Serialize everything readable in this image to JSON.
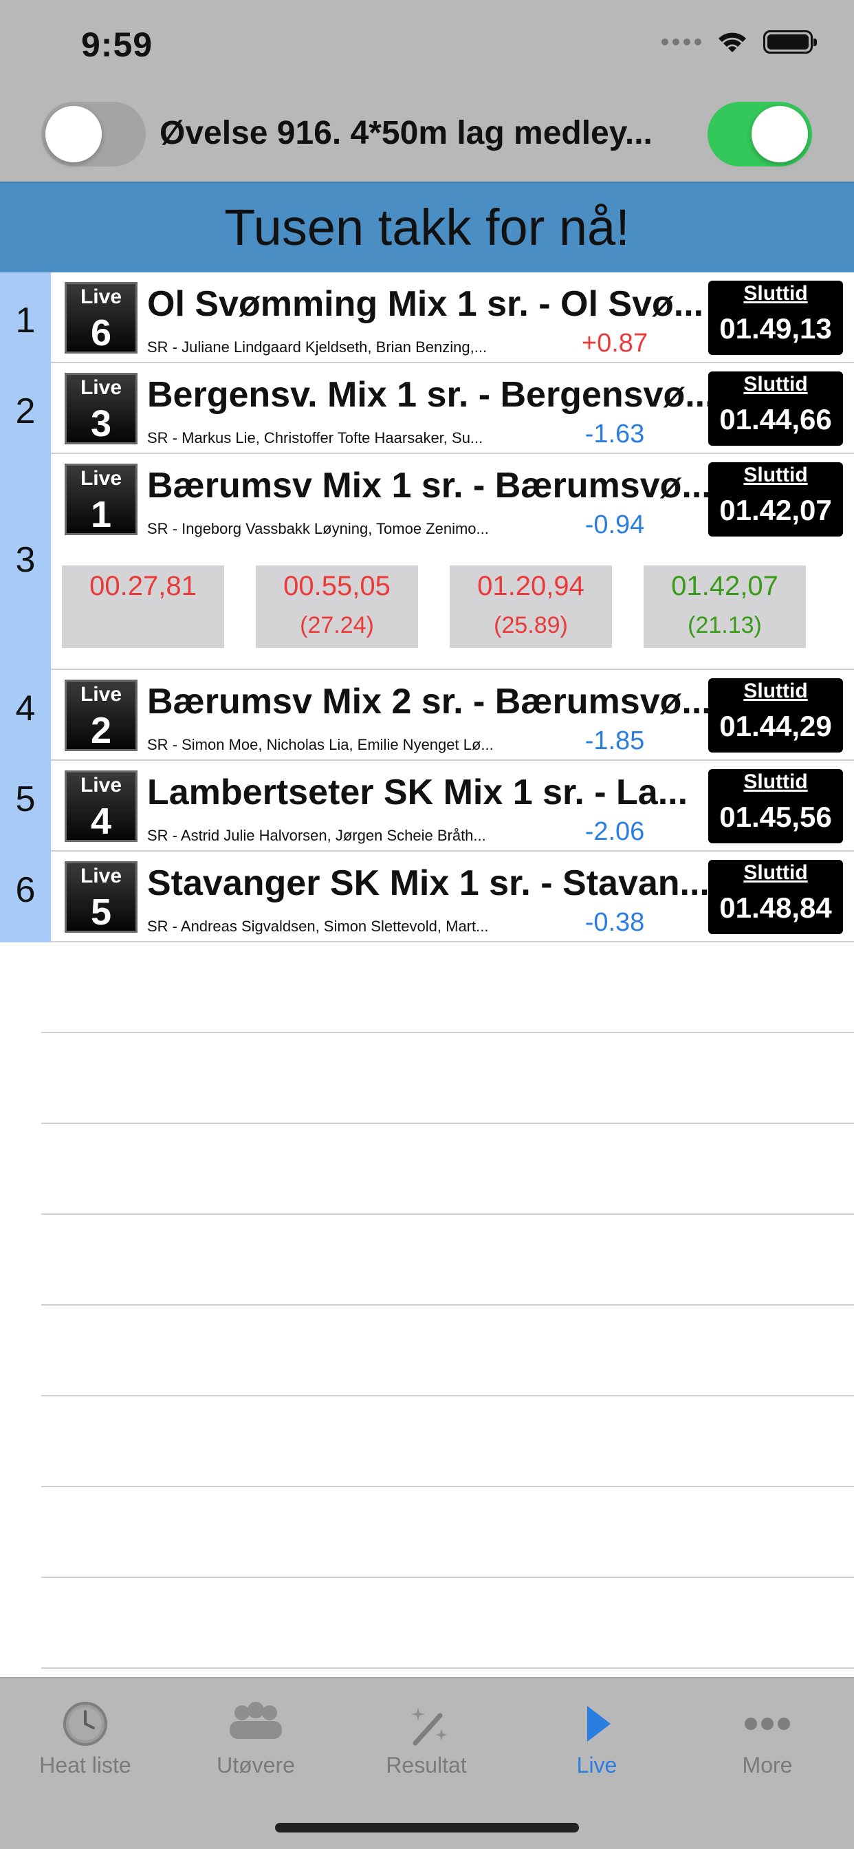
{
  "status_bar": {
    "time": "9:59"
  },
  "header": {
    "event_title": "Øvelse 916. 4*50m lag medley..."
  },
  "banner": {
    "text": "Tusen takk for nå!"
  },
  "rows": [
    {
      "rank": "1",
      "live": "Live",
      "lane": "6",
      "team": "Ol Svømming Mix 1 sr.  - Ol Svø...",
      "swimmers": "SR - Juliane Lindgaard Kjeldseth, Brian Benzing,...",
      "diff": "+0.87",
      "diff_color": "#ea3a3a",
      "final_label": "Sluttid",
      "final_time": "01.49,13"
    },
    {
      "rank": "2",
      "live": "Live",
      "lane": "3",
      "team": "Bergensv. Mix 1 sr.  - Bergensvø...",
      "swimmers": "SR - Markus Lie, Christoffer Tofte Haarsaker, Su...",
      "diff": "-1.63",
      "diff_color": "#2a7de1",
      "final_label": "Sluttid",
      "final_time": "01.44,66"
    },
    {
      "rank": "3",
      "live": "Live",
      "lane": "1",
      "team": "Bærumsv Mix 1 sr.  - Bærumsvø...",
      "swimmers": "SR - Ingeborg Vassbakk Løyning, Tomoe Zenimo...",
      "diff": "-0.94",
      "diff_color": "#2a7de1",
      "final_label": "Sluttid",
      "final_time": "01.42,07"
    },
    {
      "rank": "4",
      "live": "Live",
      "lane": "2",
      "team": "Bærumsv Mix 2 sr.  - Bærumsvø...",
      "swimmers": "SR - Simon Moe, Nicholas Lia, Emilie Nyenget Lø...",
      "diff": "-1.85",
      "diff_color": "#2a7de1",
      "final_label": "Sluttid",
      "final_time": "01.44,29"
    },
    {
      "rank": "5",
      "live": "Live",
      "lane": "4",
      "team": "Lambertseter SK Mix 1 sr.  - La...",
      "swimmers": "SR - Astrid Julie Halvorsen, Jørgen Scheie Bråth...",
      "diff": "-2.06",
      "diff_color": "#2a7de1",
      "final_label": "Sluttid",
      "final_time": "01.45,56"
    },
    {
      "rank": "6",
      "live": "Live",
      "lane": "5",
      "team": "Stavanger SK Mix 1 sr.  - Stavan...",
      "swimmers": "SR - Andreas Sigvaldsen, Simon Slettevold, Mart...",
      "diff": "-0.38",
      "diff_color": "#2a7de1",
      "final_label": "Sluttid",
      "final_time": "01.48,84"
    }
  ],
  "splits": [
    {
      "time": "00.27,81",
      "delta": "",
      "color": "#ea3a3a"
    },
    {
      "time": "00.55,05",
      "delta": "(27.24)",
      "color": "#ea3a3a"
    },
    {
      "time": "01.20,94",
      "delta": "(25.89)",
      "color": "#ea3a3a"
    },
    {
      "time": "01.42,07",
      "delta": "(21.13)",
      "color": "#3a9a1a"
    }
  ],
  "tabs": [
    {
      "label": "Heat liste",
      "icon": "clock-icon",
      "active": false
    },
    {
      "label": "Utøvere",
      "icon": "group-icon",
      "active": false
    },
    {
      "label": "Resultat",
      "icon": "magic-wand-icon",
      "active": false
    },
    {
      "label": "Live",
      "icon": "play-icon",
      "active": true
    },
    {
      "label": "More",
      "icon": "more-icon",
      "active": false
    }
  ],
  "colors": {
    "accent": "#2a7de1",
    "banner": "#4a8ec4",
    "rank_column": "#a7cbf6",
    "toggle_on": "#34c759",
    "negative": "#ea3a3a",
    "positive_split": "#3a9a1a"
  }
}
